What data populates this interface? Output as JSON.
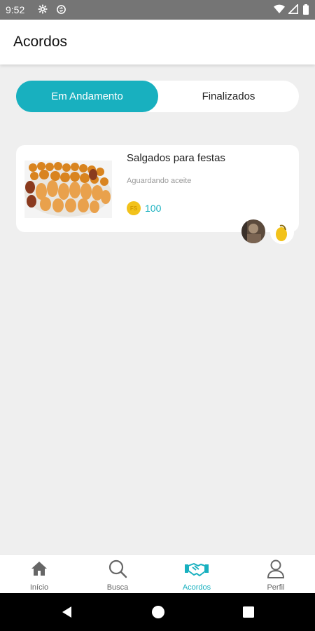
{
  "status_bar": {
    "time": "9:52"
  },
  "app_bar": {
    "title": "Acordos"
  },
  "tabs": [
    {
      "label": "Em Andamento",
      "active": true
    },
    {
      "label": "Finalizados",
      "active": false
    }
  ],
  "deals": [
    {
      "title": "Salgados para festas",
      "status": "Aguardando aceite",
      "coin_label": "FS",
      "price": "100"
    }
  ],
  "bottom_nav": [
    {
      "label": "Início",
      "icon": "home-icon"
    },
    {
      "label": "Busca",
      "icon": "search-icon"
    },
    {
      "label": "Acordos",
      "icon": "handshake-icon",
      "active": true
    },
    {
      "label": "Perfil",
      "icon": "profile-icon"
    }
  ],
  "colors": {
    "accent": "#18b0bf",
    "coin": "#f2c21b",
    "background": "#efefef"
  }
}
